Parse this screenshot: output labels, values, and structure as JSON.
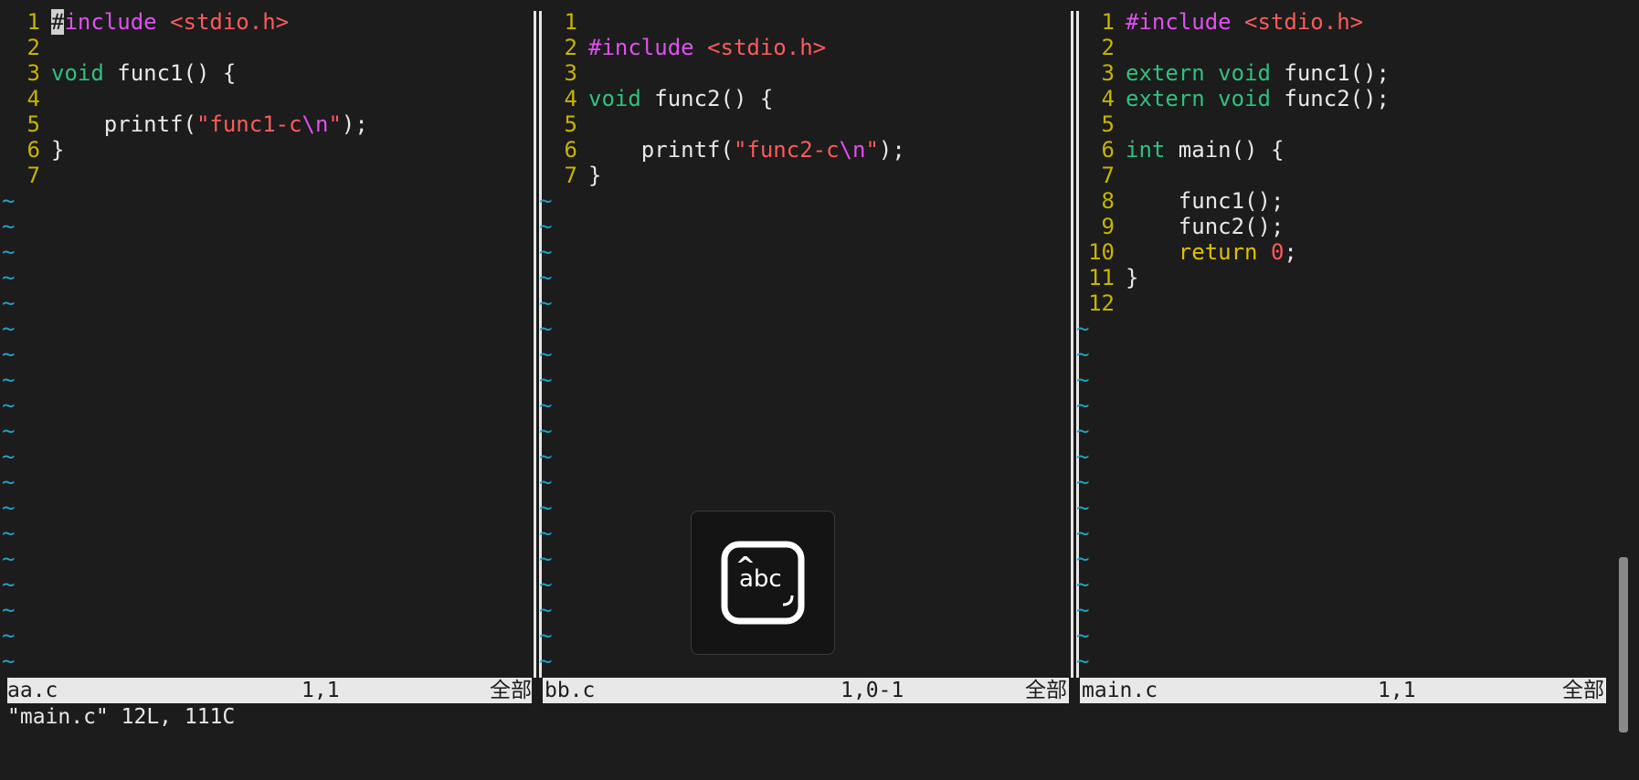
{
  "panes": [
    {
      "lines": [
        {
          "n": "1",
          "segs": [
            {
              "t": "#",
              "c": "cursor"
            },
            {
              "t": "include",
              "c": "kw-pre"
            },
            {
              "t": " "
            },
            {
              "t": "<stdio.h>",
              "c": "inc"
            }
          ]
        },
        {
          "n": "2",
          "segs": []
        },
        {
          "n": "3",
          "segs": [
            {
              "t": "void",
              "c": "type"
            },
            {
              "t": " func1() {"
            }
          ]
        },
        {
          "n": "4",
          "segs": []
        },
        {
          "n": "5",
          "segs": [
            {
              "t": "    printf("
            },
            {
              "t": "\"func1-c",
              "c": "str"
            },
            {
              "t": "\\n",
              "c": "esc"
            },
            {
              "t": "\"",
              "c": "str"
            },
            {
              "t": ");"
            }
          ]
        },
        {
          "n": "6",
          "segs": [
            {
              "t": "}"
            }
          ]
        },
        {
          "n": "7",
          "segs": []
        }
      ],
      "status": {
        "filename": "aa.c",
        "position": "1,1",
        "scroll": "全部"
      }
    },
    {
      "lines": [
        {
          "n": "1",
          "segs": []
        },
        {
          "n": "2",
          "segs": [
            {
              "t": "#include",
              "c": "kw-pre"
            },
            {
              "t": " "
            },
            {
              "t": "<stdio.h>",
              "c": "inc"
            }
          ]
        },
        {
          "n": "3",
          "segs": []
        },
        {
          "n": "4",
          "segs": [
            {
              "t": "void",
              "c": "type"
            },
            {
              "t": " func2() {"
            }
          ]
        },
        {
          "n": "5",
          "segs": []
        },
        {
          "n": "6",
          "segs": [
            {
              "t": "    printf("
            },
            {
              "t": "\"func2-c",
              "c": "str"
            },
            {
              "t": "\\n",
              "c": "esc"
            },
            {
              "t": "\"",
              "c": "str"
            },
            {
              "t": ");"
            }
          ]
        },
        {
          "n": "7",
          "segs": [
            {
              "t": "}"
            }
          ]
        }
      ],
      "status": {
        "filename": "bb.c",
        "position": "1,0-1",
        "scroll": "全部"
      }
    },
    {
      "lines": [
        {
          "n": "1",
          "segs": [
            {
              "t": "#include",
              "c": "kw-pre"
            },
            {
              "t": " "
            },
            {
              "t": "<stdio.h>",
              "c": "inc"
            }
          ]
        },
        {
          "n": "2",
          "segs": []
        },
        {
          "n": "3",
          "segs": [
            {
              "t": "extern",
              "c": "type"
            },
            {
              "t": " "
            },
            {
              "t": "void",
              "c": "type"
            },
            {
              "t": " func1();"
            }
          ]
        },
        {
          "n": "4",
          "segs": [
            {
              "t": "extern",
              "c": "type"
            },
            {
              "t": " "
            },
            {
              "t": "void",
              "c": "type"
            },
            {
              "t": " func2();"
            }
          ]
        },
        {
          "n": "5",
          "segs": []
        },
        {
          "n": "6",
          "segs": [
            {
              "t": "int",
              "c": "type"
            },
            {
              "t": " main() {"
            }
          ]
        },
        {
          "n": "7",
          "segs": []
        },
        {
          "n": "8",
          "segs": [
            {
              "t": "    func1();"
            }
          ]
        },
        {
          "n": "9",
          "segs": [
            {
              "t": "    func2();"
            }
          ]
        },
        {
          "n": "10",
          "segs": [
            {
              "t": "    "
            },
            {
              "t": "return",
              "c": "stmt"
            },
            {
              "t": " "
            },
            {
              "t": "0",
              "c": "num"
            },
            {
              "t": ";"
            }
          ]
        },
        {
          "n": "11",
          "segs": [
            {
              "t": "}"
            }
          ]
        },
        {
          "n": "12",
          "segs": []
        }
      ],
      "status": {
        "filename": "main.c",
        "position": "1,1",
        "scroll": "全部"
      }
    }
  ],
  "tilde": "~",
  "cmdline": "\"main.c\" 12L, 111C",
  "ime": {
    "label": "abc",
    "caret": "^"
  },
  "colors": {
    "background": "#1c1c1c",
    "line_number": "#c8b400",
    "tilde": "#1fa3c7",
    "preproc": "#e050f0",
    "string": "#ff5a5a",
    "type": "#2ec27e",
    "statement": "#e0c000"
  }
}
